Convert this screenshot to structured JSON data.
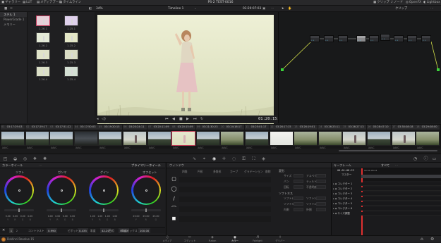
{
  "app": {
    "title": "PS-2 TEST-0016",
    "version_label": "DaVinci Resolve 15"
  },
  "topbar": {
    "left": [
      {
        "icon": "▣",
        "label": "ギャラリー"
      },
      {
        "icon": "▤",
        "label": "LUT"
      },
      {
        "icon": "▤",
        "label": "メディアプール"
      },
      {
        "icon": "▤",
        "label": "タイムライン"
      }
    ],
    "right": [
      {
        "icon": "▦",
        "label": "クリップ"
      },
      {
        "icon": "♪",
        "label": "ノード"
      },
      {
        "icon": "◎",
        "label": "OpenFX"
      },
      {
        "icon": "◐",
        "label": "Lightbox"
      }
    ]
  },
  "toolbar2": {
    "zoom": "34%",
    "timeline_name": "Timeline 1",
    "timecode": "03:20:07:03",
    "clip_selector": "クリップ"
  },
  "gallery": {
    "albums": [
      {
        "label": "スチル 1"
      },
      {
        "label": "PowerGrade 1"
      },
      {
        "label": "メモリー"
      }
    ],
    "stills": [
      "1.26.1",
      "1.25.1",
      "1.26.2",
      "1.25.2",
      "1.26.3",
      "1.25.3",
      "1.26.4",
      "1.25.4"
    ]
  },
  "viewer": {
    "timecode": "01:20:15:08"
  },
  "clips": [
    {
      "num": "01",
      "tc": "03:17:29:03",
      "codec": "XAVC",
      "scene": "sky"
    },
    {
      "num": "02",
      "tc": "03:17:29:17",
      "codec": "XAVC",
      "scene": "sky"
    },
    {
      "num": "03",
      "tc": "03:17:51:22",
      "codec": "XAVC",
      "scene": "sky"
    },
    {
      "num": "04",
      "tc": "03:17:50:03",
      "codec": "XAVC",
      "scene": "dark"
    },
    {
      "num": "05",
      "tc": "03:19:20:15",
      "codec": "XAVC",
      "scene": "sky"
    },
    {
      "num": "06",
      "tc": "03:20:24:11",
      "codec": "XAVC",
      "scene": "girl"
    },
    {
      "num": "07",
      "tc": "03:20:11:09",
      "codec": "XAVC",
      "scene": "sky"
    },
    {
      "num": "08",
      "tc": "03:20:15:09",
      "codec": "XAVC",
      "scene": "sel"
    },
    {
      "num": "09",
      "tc": "03:21:30:23",
      "codec": "XAVC",
      "scene": "sky"
    },
    {
      "num": "10",
      "tc": "03:24:16:17",
      "codec": "XAVC",
      "scene": "grass"
    },
    {
      "num": "11",
      "tc": "03:25:01:17",
      "codec": "XAVC",
      "scene": "sky"
    },
    {
      "num": "12",
      "tc": "03:26:17:15",
      "codec": "XAVC",
      "scene": "bright"
    },
    {
      "num": "13",
      "tc": "03:26:19:01",
      "codec": "XAVC",
      "scene": "grass"
    },
    {
      "num": "14",
      "tc": "03:26:23:11",
      "codec": "XAVC",
      "scene": "grass"
    },
    {
      "num": "15",
      "tc": "03:26:27:13",
      "codec": "XAVC",
      "scene": "girl"
    },
    {
      "num": "16",
      "tc": "03:28:47:10",
      "codec": "XAVC",
      "scene": "sky"
    },
    {
      "num": "17",
      "tc": "03:30:08:18",
      "codec": "XAVC",
      "scene": "girl"
    },
    {
      "num": "18",
      "tc": "03:29:08:00",
      "codec": "XAVC",
      "scene": "grass"
    }
  ],
  "color_wheels": {
    "header": "カラーホイール",
    "mode": "プライマリーホイール",
    "wheels": [
      {
        "label": "リフト",
        "values": [
          "0.00",
          "0.00",
          "0.00",
          "0.00"
        ]
      },
      {
        "label": "ガンマ",
        "values": [
          "0.00",
          "0.00",
          "0.00",
          "0.00"
        ]
      },
      {
        "label": "ゲイン",
        "values": [
          "1.00",
          "1.00",
          "1.00",
          "1.00"
        ]
      },
      {
        "label": "オフセット",
        "values": [
          "25.00",
          "25.00",
          "25.00"
        ]
      }
    ],
    "footer": [
      {
        "label": "コントラスト",
        "value": "0.990"
      },
      {
        "label": "ピボット",
        "value": "0.435"
      },
      {
        "label": "彩度",
        "value": "42.20"
      },
      {
        "label": "色相",
        "value": "50.00"
      },
      {
        "label": "輝度ミックス",
        "value": "100.00"
      }
    ],
    "page_buttons": [
      "1",
      "2"
    ]
  },
  "window_panel": {
    "header": "ウィンドウ",
    "tools": [
      "四角",
      "円形",
      "多角形",
      "カーブ",
      "グラデーション"
    ],
    "delete_label": "削除",
    "transform_title": "変形",
    "transform_fields": [
      "サイズ",
      "アスペクト",
      "パン",
      "ティルト",
      "回転",
      "不透明度"
    ],
    "softness_title": "ソフトネス",
    "softness_fields": [
      "ソフト1",
      "ソフト2",
      "ソフト3",
      "ソフト4",
      "内側",
      "外側"
    ]
  },
  "keyframes": {
    "header": "キーフレーム",
    "all_label": "すべて",
    "timecode_a": "00:01:08:23",
    "timecode_b": "00:01:08:23",
    "track_master": "マスター",
    "tracks": [
      "コレクター 1",
      "コレクター 2",
      "コレクター 3",
      "コレクター 4",
      "コレクター 5",
      "コレクター 6",
      "サイズ調整"
    ]
  },
  "bottom_nav": [
    {
      "icon": "♫",
      "label": "メディア"
    },
    {
      "icon": "✂",
      "label": "エディット"
    },
    {
      "icon": "◈",
      "label": "Fusion"
    },
    {
      "icon": "◉",
      "label": "カラー",
      "active": true
    },
    {
      "icon": "♬",
      "label": "Fairlight"
    },
    {
      "icon": "⇪",
      "label": "デリバー"
    }
  ],
  "colors": {
    "accent_selected": "#c43b57",
    "node_link": "#d6e24a",
    "playhead": "#e03030"
  }
}
